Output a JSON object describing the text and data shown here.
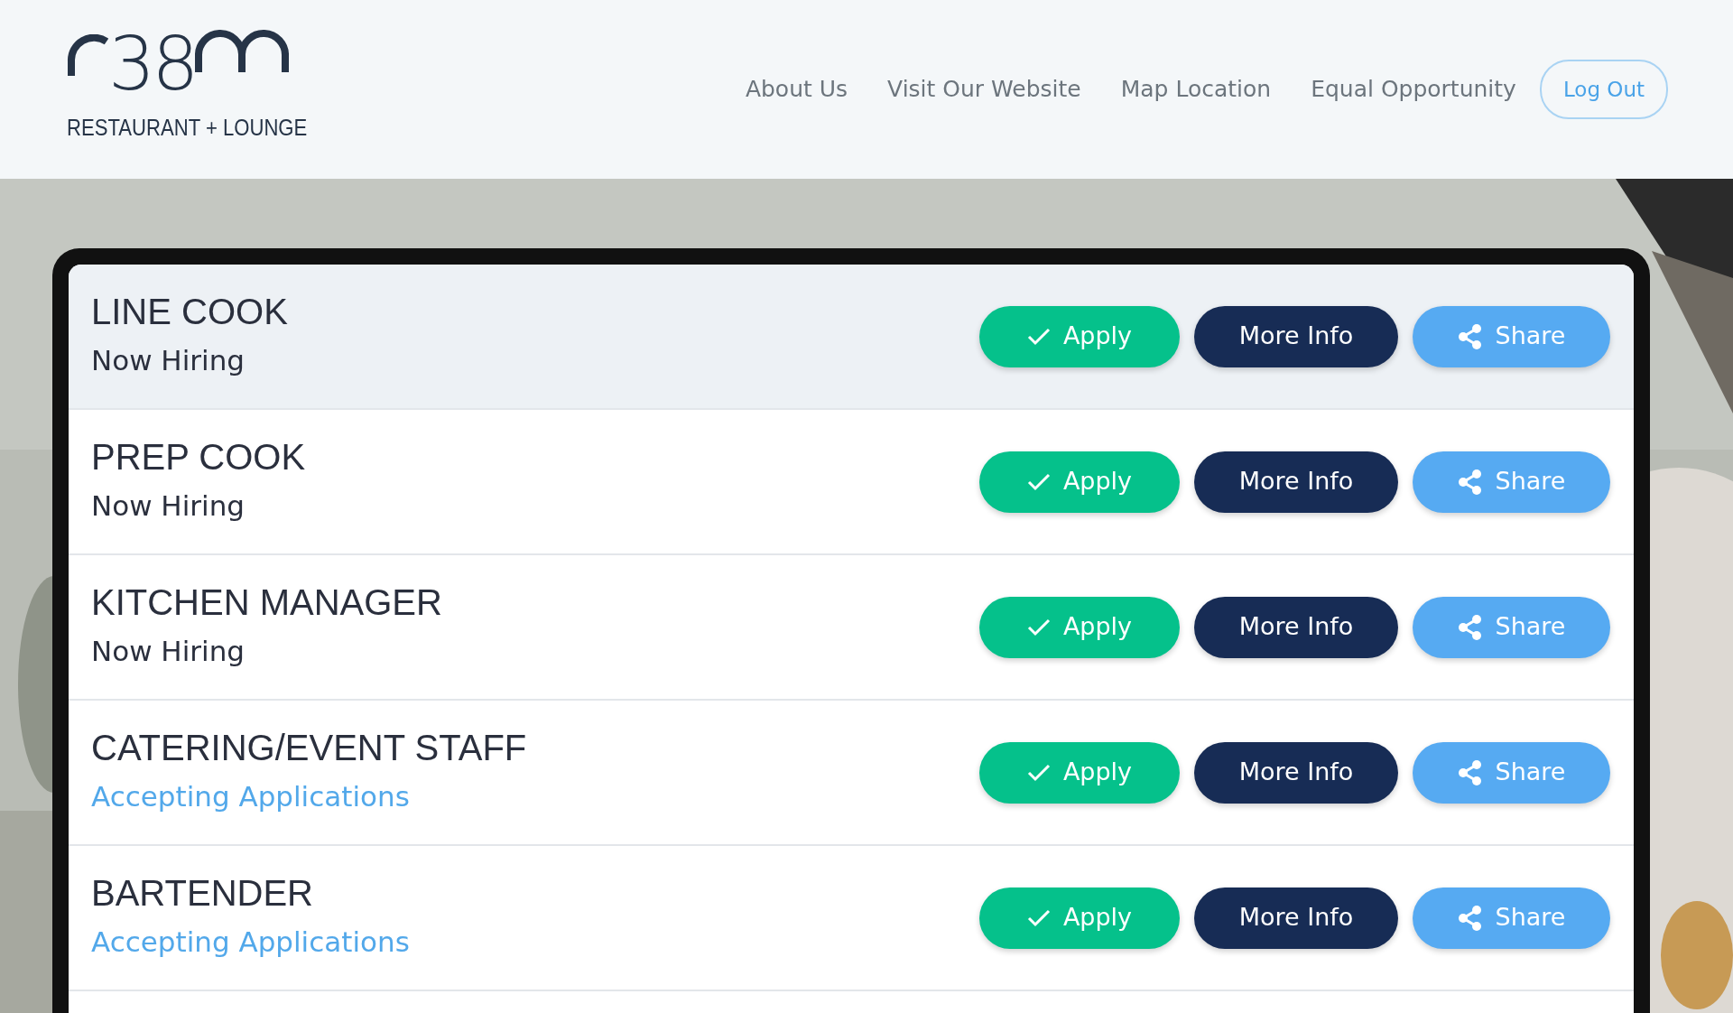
{
  "header": {
    "logo": {
      "mark": "38",
      "tagline": "RESTAURANT + LOUNGE"
    },
    "nav": [
      {
        "label": "About Us",
        "kind": "link"
      },
      {
        "label": "Visit Our Website",
        "kind": "link"
      },
      {
        "label": "Map Location",
        "kind": "link"
      },
      {
        "label": "Equal Opportunity",
        "kind": "link"
      },
      {
        "label": "Log Out",
        "kind": "outline"
      }
    ]
  },
  "jobs": [
    {
      "title": "LINE COOK",
      "status": "Now Hiring",
      "color": "#2a2f3d",
      "highlighted": true,
      "buttons": [
        "Apply",
        "More Info",
        "Share"
      ]
    },
    {
      "title": "PREP COOK",
      "status": "Now Hiring",
      "color": "#2a2f3d",
      "highlighted": false,
      "buttons": [
        "Apply",
        "More Info",
        "Share"
      ]
    },
    {
      "title": "KITCHEN MANAGER",
      "status": "Now Hiring",
      "color": "#2a2f3d",
      "highlighted": false,
      "buttons": [
        "Apply",
        "More Info",
        "Share"
      ]
    },
    {
      "title": "CATERING/EVENT STAFF",
      "status": "Accepting Applications",
      "color": "#52a8ea",
      "highlighted": false,
      "buttons": [
        "Apply",
        "More Info",
        "Share"
      ]
    },
    {
      "title": "BARTENDER",
      "status": "Accepting Applications",
      "color": "#52a8ea",
      "highlighted": false,
      "buttons": [
        "Apply",
        "More Info",
        "Share"
      ]
    }
  ]
}
